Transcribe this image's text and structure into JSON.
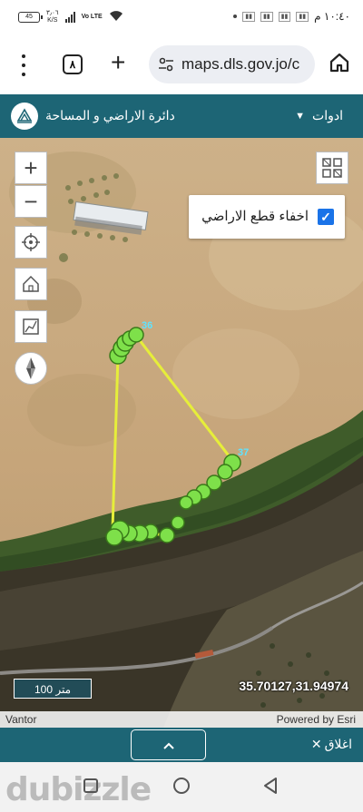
{
  "status_bar": {
    "battery": "45",
    "net_speed_value": "٣٫٠٦",
    "net_speed_unit": "K/S",
    "network": "Vo LTE",
    "time": "١٠:٤٠ م"
  },
  "browser": {
    "tab_count": "٨",
    "url": "maps.dls.gov.jo/c"
  },
  "app_header": {
    "title": "دائرة الاراضي و المساحة",
    "tools_label": "ادوات"
  },
  "map": {
    "controls": [
      "zoom-in",
      "zoom-out",
      "locate",
      "home",
      "measure",
      "compass"
    ],
    "parcels_toggle": {
      "label": "اخفاء قطع الاراضي",
      "checked": true
    },
    "point_labels": {
      "top": "36",
      "right": "37"
    },
    "scale_label": "100 متر",
    "coordinates": "35.70127,31.94974",
    "attribution_left": "Vantor",
    "attribution_right": "Powered by Esri",
    "line_color": "#e6ee3a",
    "point_color": "#7ee04a"
  },
  "bottom_bar": {
    "expand_icon": "chevron-up",
    "close_label": "اغلاق"
  },
  "watermark": "dubizzle"
}
